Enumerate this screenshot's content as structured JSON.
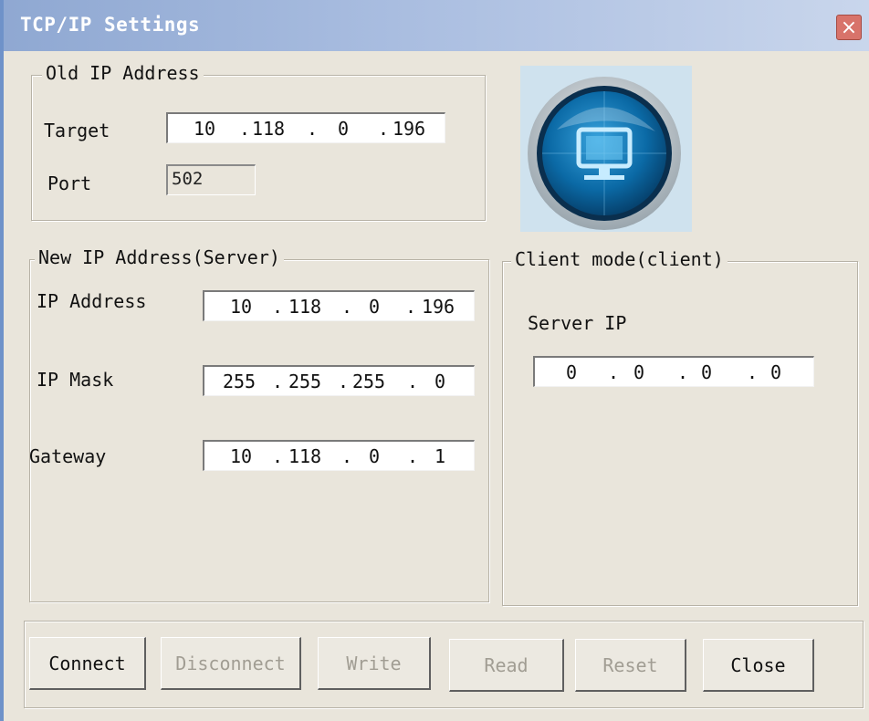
{
  "window": {
    "title": "TCP/IP Settings",
    "close_glyph": "×"
  },
  "old_ip": {
    "legend": "Old IP Address",
    "target_label": "Target",
    "target_octets": [
      "10",
      "118",
      "0",
      "196"
    ],
    "port_label": "Port",
    "port_value": "502"
  },
  "new_ip": {
    "legend": "New IP Address(Server)",
    "ip_label": "IP Address",
    "ip_octets": [
      "10",
      "118",
      "0",
      "196"
    ],
    "mask_label": "IP Mask",
    "mask_octets": [
      "255",
      "255",
      "255",
      "0"
    ],
    "gateway_label": "Gateway",
    "gateway_octets": [
      "10",
      "118",
      "0",
      "1"
    ]
  },
  "client": {
    "legend": "Client mode(client)",
    "server_ip_label": "Server IP",
    "server_ip_octets": [
      "0",
      "0",
      "0",
      "0"
    ]
  },
  "buttons": {
    "connect": "Connect",
    "disconnect": "Disconnect",
    "write": "Write",
    "read": "Read",
    "reset": "Reset",
    "close": "Close"
  },
  "ip_separator": ".",
  "logo_icon": "network-monitor-icon"
}
